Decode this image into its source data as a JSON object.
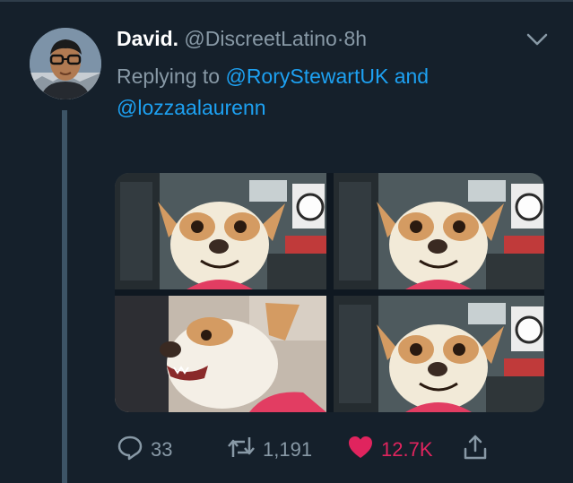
{
  "tweet": {
    "author_name": "David.",
    "author_handle": "@DiscreetLatino",
    "separator": "·",
    "time": "8h",
    "replying_prefix": "Replying to",
    "replying_mention_1": "@RoryStewartUK",
    "replying_conjunction": "and",
    "replying_mention_2": "@lozzaalaurenn",
    "media_count": 4
  },
  "actions": {
    "reply_count": "33",
    "retweet_count": "1,191",
    "like_count": "12.7K",
    "liked": true
  },
  "icons": {
    "caret": "chevron-down-icon",
    "reply": "speech-bubble-icon",
    "retweet": "retweet-arrows-icon",
    "like": "heart-icon",
    "share": "share-upload-icon"
  },
  "colors": {
    "background": "#15202b",
    "link": "#1da1f2",
    "muted": "#8899a6",
    "like": "#e0245e",
    "thread_line": "#3d5466"
  }
}
